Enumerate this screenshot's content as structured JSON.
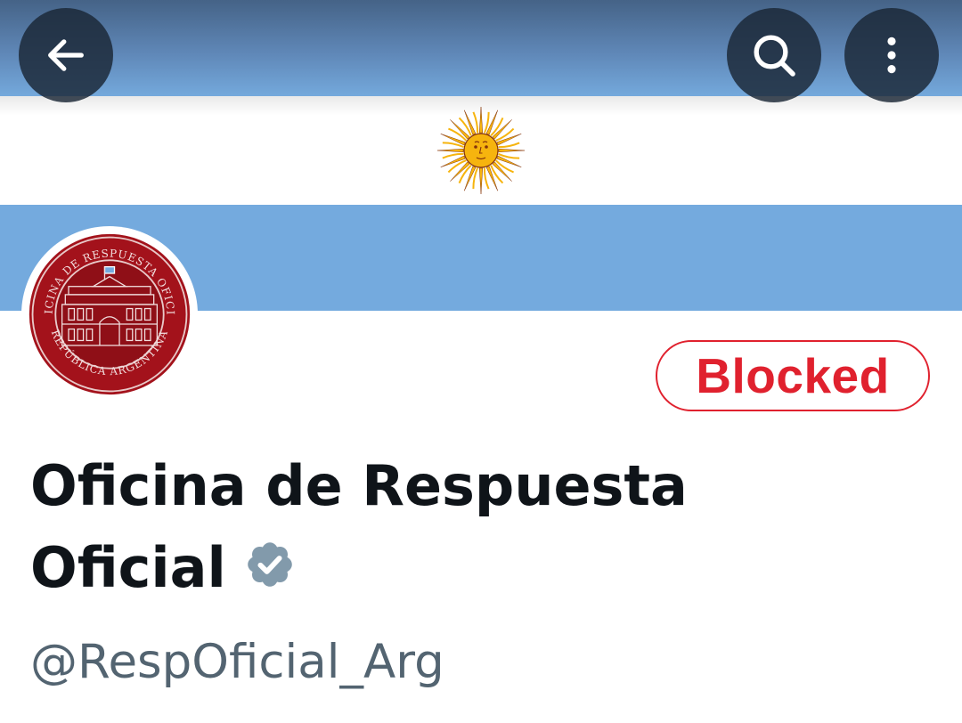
{
  "navigation": {
    "back_icon": "arrow-left-icon",
    "search_icon": "search-icon",
    "more_icon": "more-vertical-icon"
  },
  "banner": {
    "description_icon": "sun-of-may-icon",
    "colors": {
      "light_blue": "#74aade",
      "white": "#ffffff",
      "sun": "#f6b40e"
    }
  },
  "profile": {
    "avatar_seal": {
      "top_arc": "OFICINA DE RESPUESTA OFICIAL",
      "bottom_arc": "REPÚBLICA ARGENTINA"
    },
    "action_button_label": "Blocked",
    "name_line1": "Oficina de Respuesta",
    "name_line2": "Oficial",
    "verified_icon": "verified-badge-icon",
    "handle": "@RespOficial_Arg"
  },
  "colors": {
    "blocked_red": "#e0212e",
    "name_text": "#0f1419",
    "handle_text": "#536471",
    "verified_badge": "#829aab"
  }
}
